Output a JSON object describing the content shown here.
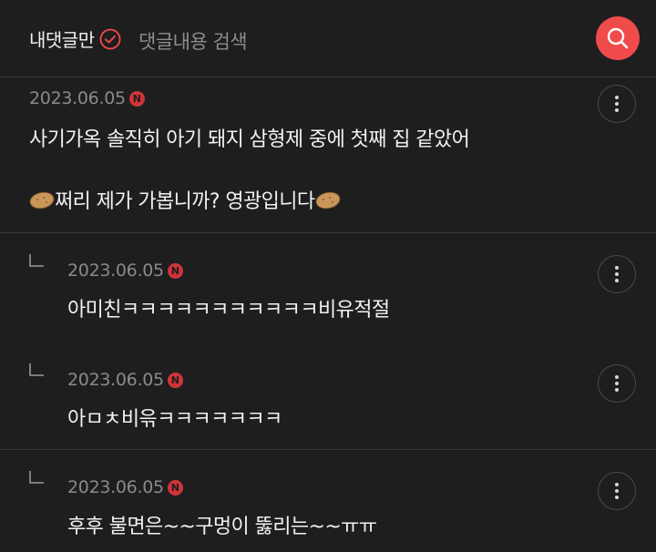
{
  "header": {
    "my_comments_label": "내댓글만",
    "search_placeholder": "댓글내용 검색"
  },
  "comments": [
    {
      "date": "2023.06.05",
      "badge": "N",
      "line1": "사기가옥 솔직히 아기 돼지 삼형제 중에 첫째 집 같았어",
      "line2": "쩌리 제가 가봅니까? 영광입니다"
    },
    {
      "date": "2023.06.05",
      "badge": "N",
      "line1": "아미친ㅋㅋㅋㅋㅋㅋㅋㅋㅋㅋㅋ비유적절"
    },
    {
      "date": "2023.06.05",
      "badge": "N",
      "line1": "아ㅁㅊ비윾ㅋㅋㅋㅋㅋㅋㅋ"
    },
    {
      "date": "2023.06.05",
      "badge": "N",
      "line1": "후후 불면은~~구멍이 뚫리는~~ㅠㅠ"
    }
  ],
  "colors": {
    "background": "#1e1e1f",
    "accent": "#f04b4b",
    "badge": "#d0343a"
  },
  "icons": [
    "check-circle-icon",
    "search-icon",
    "more-vertical-icon",
    "reply-arrow-icon",
    "potato-emoji-icon",
    "new-badge-icon"
  ]
}
